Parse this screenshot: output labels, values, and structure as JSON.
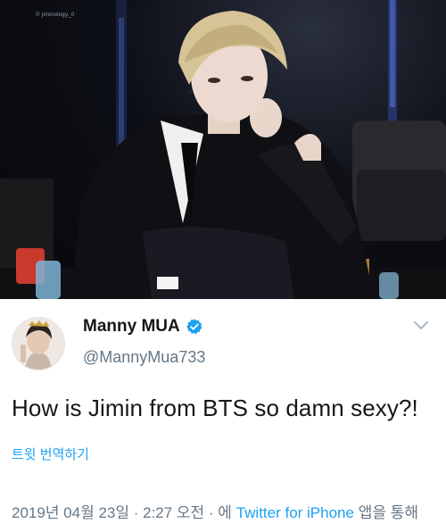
{
  "photo": {
    "watermark": "© jiminology_0",
    "description_icon": "photo-image"
  },
  "tweet": {
    "display_name": "Manny MUA",
    "handle": "@MannyMua733",
    "verified_icon": "verified-badge-icon",
    "text": "How is Jimin from BTS so damn sexy?!",
    "translate_label": "트윗 번역하기",
    "timestamp": "2019년 04월 23일 · 2:27 오전 · 에",
    "source": "Twitter for iPhone",
    "source_suffix": "앱을 통해",
    "menu_icon": "chevron-down-icon"
  },
  "colors": {
    "accent": "#1da1f2",
    "text": "#14171a",
    "muted": "#657786"
  }
}
